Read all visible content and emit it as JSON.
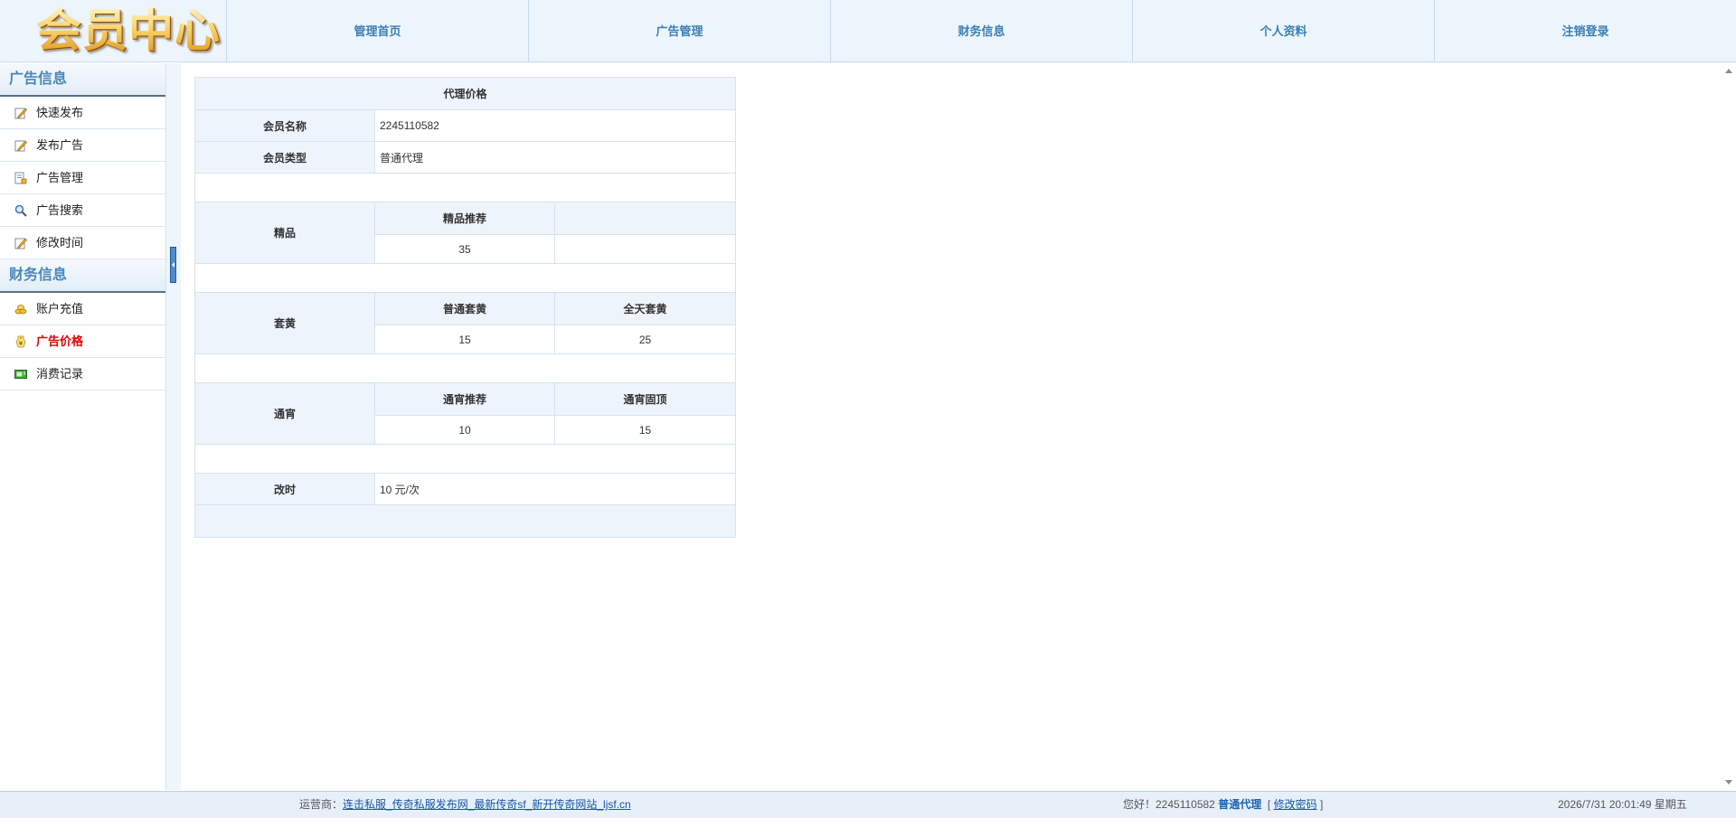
{
  "header": {
    "logo_text": "会员中心",
    "nav": [
      "管理首页",
      "广告管理",
      "财务信息",
      "个人资料",
      "注销登录"
    ]
  },
  "sidebar": {
    "sections": [
      {
        "title": "广告信息",
        "items": [
          {
            "label": "快速发布",
            "icon": "edit-icon"
          },
          {
            "label": "发布广告",
            "icon": "edit-icon"
          },
          {
            "label": "广告管理",
            "icon": "document-manage-icon"
          },
          {
            "label": "广告搜索",
            "icon": "search-icon"
          },
          {
            "label": "修改时间",
            "icon": "edit-icon"
          }
        ]
      },
      {
        "title": "财务信息",
        "items": [
          {
            "label": "账户充值",
            "icon": "coins-icon"
          },
          {
            "label": "广告价格",
            "icon": "price-tag-icon",
            "active": true
          },
          {
            "label": "消费记录",
            "icon": "ledger-icon"
          }
        ]
      }
    ]
  },
  "table": {
    "title": "代理价格",
    "member_name_label": "会员名称",
    "member_name": "2245110582",
    "member_type_label": "会员类型",
    "member_type": "普通代理",
    "jingpin": {
      "label": "精品",
      "headers": [
        "精品推荐",
        ""
      ],
      "values": [
        "35",
        ""
      ]
    },
    "taohuang": {
      "label": "套黄",
      "headers": [
        "普通套黄",
        "全天套黄"
      ],
      "values": [
        "15",
        "25"
      ]
    },
    "tongxiao": {
      "label": "通宵",
      "headers": [
        "通宵推荐",
        "通宵固顶"
      ],
      "values": [
        "10",
        "15"
      ]
    },
    "change_time_label": "改时",
    "change_time_value": "10 元/次"
  },
  "footer": {
    "operator_label": "运营商：",
    "operator_link": "连击私服_传奇私服发布网_最新传奇sf_新开传奇网站_ljsf.cn",
    "greeting": "您好！2245110582",
    "user_level": "普通代理",
    "bracket_open": "[",
    "change_password": "修改密码",
    "bracket_close": "]",
    "datetime": "2026/7/31 20:01:49 星期五"
  },
  "colors": {
    "nav_text": "#3b7fb3",
    "section_title": "#4a87b8",
    "active_menu": "#e60000",
    "table_header_bg": "#eef4fb",
    "border": "#d4e3f0"
  }
}
